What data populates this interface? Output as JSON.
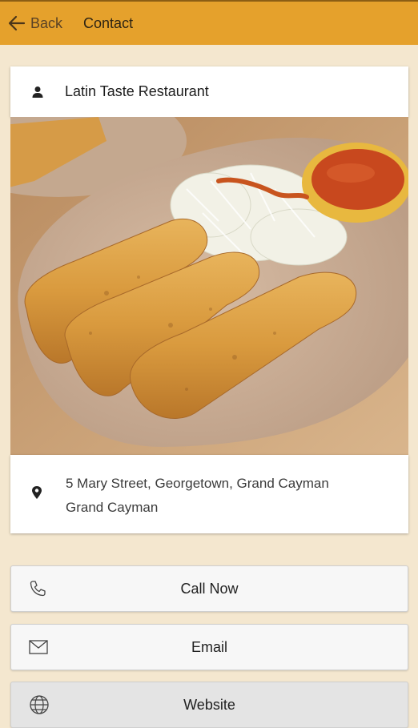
{
  "header": {
    "back_label": "Back",
    "title": "Contact"
  },
  "restaurant": {
    "name": "Latin Taste Restaurant",
    "icon": "person-icon"
  },
  "photo": {
    "subject": "fried taquitos with shredded cabbage and salsa"
  },
  "address": {
    "line1": "5 Mary Street, Georgetown, Grand Cayman",
    "line2": "Grand Cayman",
    "icon": "map-pin-icon"
  },
  "actions": {
    "call": {
      "label": "Call Now",
      "icon": "phone-icon"
    },
    "email": {
      "label": "Email",
      "icon": "envelope-icon"
    },
    "website": {
      "label": "Website",
      "icon": "globe-icon"
    }
  },
  "colors": {
    "header_bg": "#e5a12c",
    "page_bg": "#f4e7cf",
    "button_bg": "#f7f7f7"
  }
}
